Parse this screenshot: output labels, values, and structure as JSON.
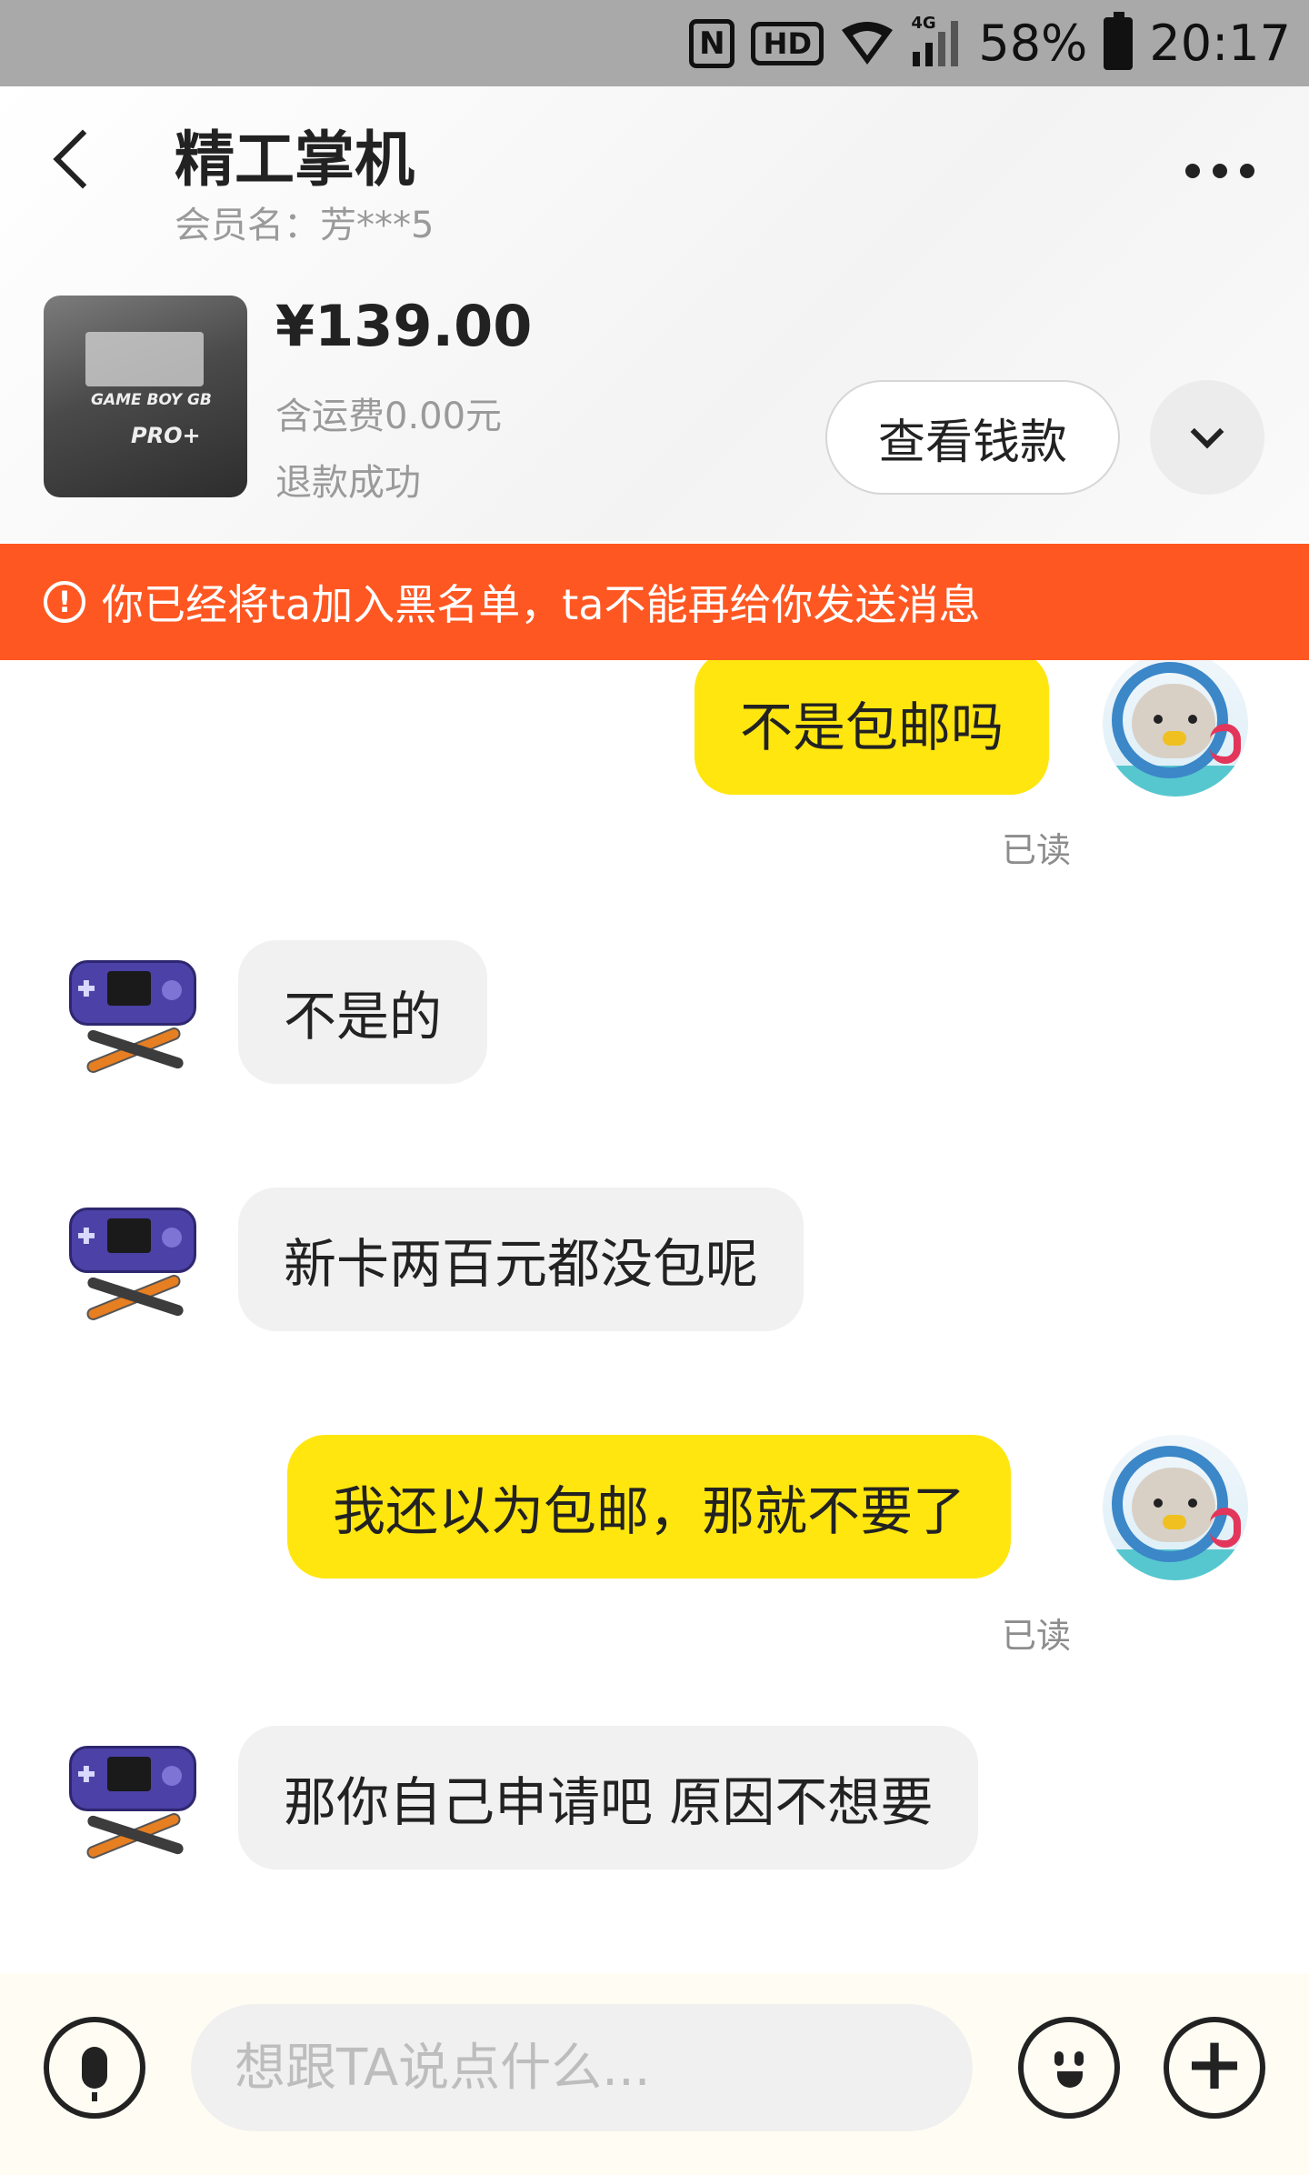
{
  "status_bar": {
    "nfc_label": "N",
    "hd_label": "HD",
    "network_label": "4G",
    "battery": "58%",
    "time": "20:17"
  },
  "header": {
    "title": "精工掌机",
    "member": "会员名：芳***5"
  },
  "product": {
    "price": "¥139.00",
    "shipping": "含运费0.00元",
    "status": "退款成功",
    "view_button": "查看钱款",
    "image_text": {
      "brand": "GAME BOY GB",
      "model": "PRO+"
    }
  },
  "banner": {
    "text": "你已经将ta加入黑名单，ta不能再给你发送消息"
  },
  "messages": [
    {
      "from": "me",
      "text": "不是包邮吗",
      "read": "已读"
    },
    {
      "from": "them",
      "text": "不是的"
    },
    {
      "from": "them",
      "text": "新卡两百元都没包呢"
    },
    {
      "from": "me",
      "text": "我还以为包邮，那就不要了",
      "read": "已读"
    },
    {
      "from": "them",
      "text": "那你自己申请吧 原因不想要"
    }
  ],
  "input": {
    "placeholder": "想跟TA说点什么..."
  },
  "colors": {
    "mine_bubble": "#ffe60f",
    "theirs_bubble": "#f1f1f1",
    "banner": "#ff5722"
  }
}
